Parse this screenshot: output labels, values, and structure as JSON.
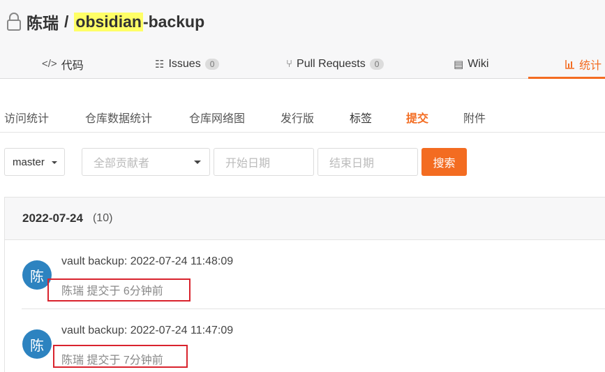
{
  "repo": {
    "owner": "陈瑞",
    "separator": "/",
    "name_highlight": "obsidian",
    "name_rest": "-backup",
    "highlight_color": "#ffff66"
  },
  "tabs": [
    {
      "icon": "code-icon",
      "glyph": "</>",
      "label": "代码"
    },
    {
      "icon": "issues-icon",
      "glyph": "☷",
      "label": "Issues",
      "badge": "0"
    },
    {
      "icon": "pull-request-icon",
      "glyph": "⑂",
      "label": "Pull Requests",
      "badge": "0"
    },
    {
      "icon": "wiki-icon",
      "glyph": "▤",
      "label": "Wiki"
    },
    {
      "icon": "stats-icon",
      "glyph": "📊",
      "label": "统计",
      "active": true
    }
  ],
  "subnav": [
    "访问统计",
    "仓库数据统计",
    "仓库网络图",
    "发行版",
    "标签",
    "提交",
    "附件"
  ],
  "filters": {
    "branch": "master",
    "contributor_placeholder": "全部贡献者",
    "start_placeholder": "开始日期",
    "end_placeholder": "结束日期",
    "search_label": "搜索"
  },
  "commits_group": {
    "date": "2022-07-24",
    "count": "(10)"
  },
  "commits": [
    {
      "avatar": "陈",
      "message": "vault backup: 2022-07-24 11:48:09",
      "meta": "陈瑞 提交于 6分钟前"
    },
    {
      "avatar": "陈",
      "message": "vault backup: 2022-07-24 11:47:09",
      "meta": "陈瑞 提交于 7分钟前"
    }
  ],
  "colors": {
    "accent": "#f36c21",
    "avatar": "#2d83c0",
    "annotation": "#d9232d"
  }
}
